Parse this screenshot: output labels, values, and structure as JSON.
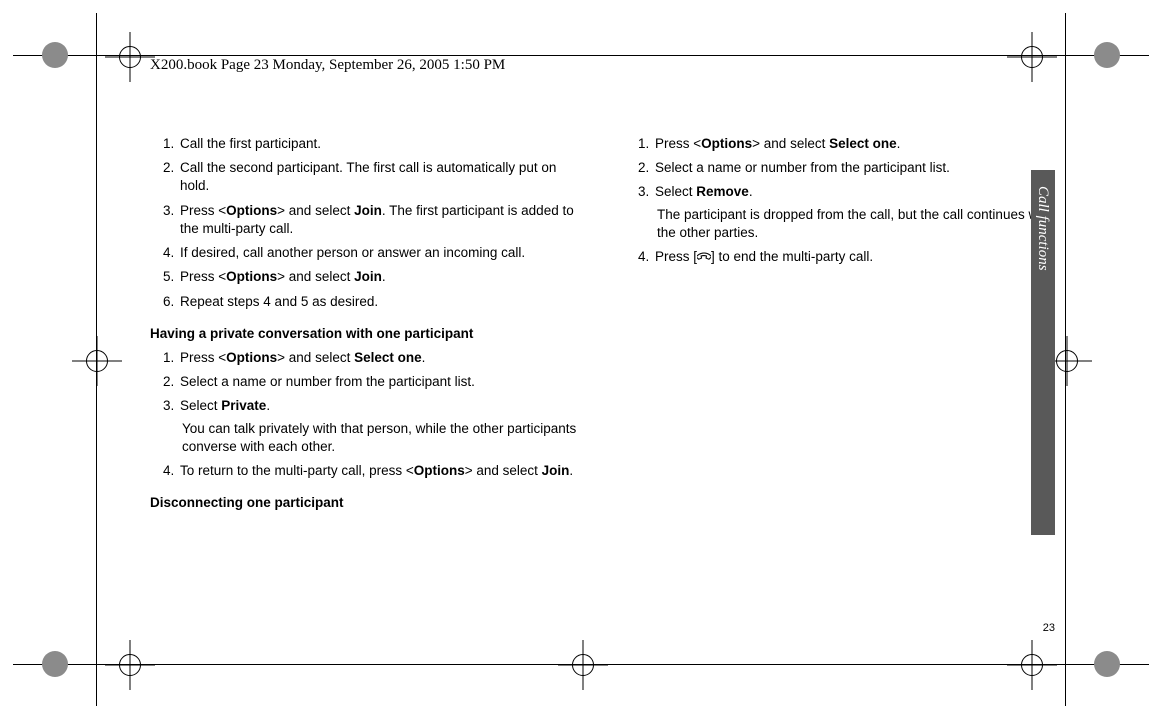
{
  "header": {
    "text": "X200.book  Page 23  Monday, September 26, 2005  1:50 PM"
  },
  "page_number": "23",
  "side_tab": "Call functions",
  "col1": {
    "li1": "Call the first participant.",
    "li2": "Call the second participant. The first call is automatically put on hold.",
    "li3_a": "Press <",
    "li3_opt": "Options",
    "li3_b": "> and select ",
    "li3_join": "Join",
    "li3_c": ". The first participant is added to the multi-party call.",
    "li4": "If desired, call another person or answer an incoming call.",
    "li5_a": "Press <",
    "li5_opt": "Options",
    "li5_b": "> and select ",
    "li5_join": "Join",
    "li5_c": ".",
    "li6": "Repeat steps 4 and 5 as desired.",
    "sub1": "Having a private conversation with one participant",
    "p1_a": "Press <",
    "p1_opt": "Options",
    "p1_b": "> and select ",
    "p1_sel": "Select one",
    "p1_c": ".",
    "p2": "Select a name or number from the participant list.",
    "p3_a": "Select ",
    "p3_priv": "Private",
    "p3_b": ".",
    "p3_sub": "You can talk privately with that person, while the other participants converse with each other.",
    "p4_a": "To return to the multi-party call, press <",
    "p4_opt": "Options",
    "p4_b": "> and select ",
    "p4_join": "Join",
    "p4_c": ".",
    "sub2": "Disconnecting one participant"
  },
  "col2": {
    "d1_a": "Press <",
    "d1_opt": "Options",
    "d1_b": "> and select ",
    "d1_sel": "Select one",
    "d1_c": ".",
    "d2": "Select a name or number from the participant list.",
    "d3_a": "Select ",
    "d3_rem": "Remove",
    "d3_b": ".",
    "d3_sub": "The participant is dropped from the call, but the call continues with the other parties.",
    "d4_a": "Press [",
    "d4_b": "] to end the multi-party call."
  }
}
